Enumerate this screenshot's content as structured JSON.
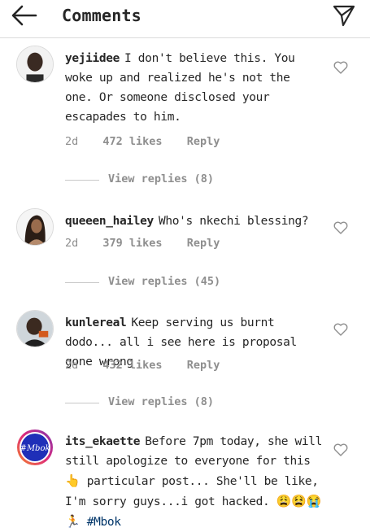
{
  "header": {
    "title": "Comments",
    "back_icon": "back-arrow-icon",
    "send_icon": "direct-send-icon"
  },
  "comments": [
    {
      "username": "yejiidee",
      "text": "I don't believe this.  You woke up and realized he's not the one.  Or someone disclosed your escapades to him.",
      "time": "2d",
      "likes": "472 likes",
      "reply": "Reply",
      "view_replies": "View replies (8)"
    },
    {
      "username": "queeen_hailey",
      "text": "Who's nkechi blessing?",
      "time": "2d",
      "likes": "379 likes",
      "reply": "Reply",
      "view_replies": "View replies (45)"
    },
    {
      "username": "kunlereal",
      "text": "Keep serving us burnt dodo... all i see here is proposal gone wrong",
      "time": "2d",
      "likes": "432 likes",
      "reply": "Reply",
      "view_replies": "View replies (8)"
    },
    {
      "username": "its_ekaette",
      "text": "Before 7pm today, she will still apologize to everyone for this",
      "text2": "particular post... She'll be like, I'm sorry guys...i got hacked.",
      "emojis_a": "👆",
      "emojis_b": "😩😫😭🏃",
      "hashtag": "#Mbok",
      "avatar_label": "#Mbok"
    }
  ],
  "colors": {
    "text": "#262626",
    "muted": "#8e8e8e",
    "divider": "#dbdbdb",
    "hashtag": "#003569"
  }
}
